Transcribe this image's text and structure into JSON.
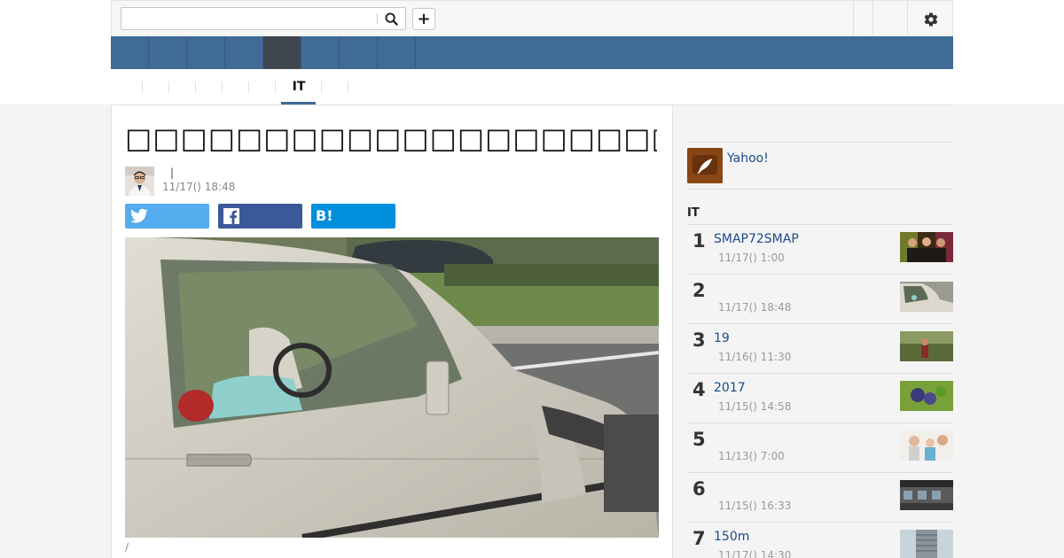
{
  "header": {
    "search": {
      "value": "",
      "placeholder": ""
    },
    "icons": {
      "search": "search-icon",
      "add": "plus-icon",
      "settings": "gear-icon"
    },
    "plus_label": "+"
  },
  "nav": {
    "items": 9,
    "active_index": 5
  },
  "subtabs": {
    "active_label": "IT"
  },
  "article": {
    "title": "□□□□□□□□□□□□□□□□□□□□□□□□□□□□□□□□□□□□",
    "author_separator": "|",
    "time": "11/17() 18:48",
    "share": {
      "hatena_label": "B!"
    },
    "caption": "/"
  },
  "sidebar": {
    "promo": {
      "label": "Yahoo!"
    },
    "ranking_heading": "IT",
    "ranking": [
      {
        "num": "1",
        "title": "SMAP72SMAP",
        "time": "11/17() 1:00"
      },
      {
        "num": "2",
        "title": "",
        "time": "11/17() 18:48"
      },
      {
        "num": "3",
        "title": "19",
        "time": "11/16() 11:30"
      },
      {
        "num": "4",
        "title": "2017",
        "time": "11/15() 14:58"
      },
      {
        "num": "5",
        "title": "",
        "time": "11/13() 7:00"
      },
      {
        "num": "6",
        "title": "",
        "time": "11/15() 16:33"
      },
      {
        "num": "7",
        "title": "150m",
        "time": "11/17() 14:30"
      }
    ]
  },
  "colors": {
    "nav_blue": "#3f6b96",
    "nav_active": "#404650",
    "link_blue": "#1a4a8a",
    "twitter": "#55acee",
    "facebook": "#3b5998",
    "hatena": "#008fde"
  }
}
